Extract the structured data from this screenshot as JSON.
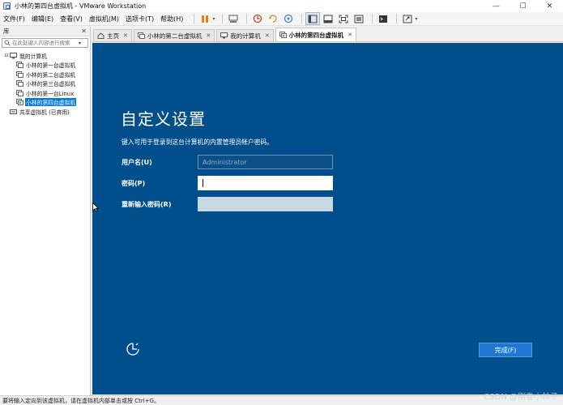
{
  "window": {
    "title": "小林的第四台虚拟机 - VMware Workstation",
    "minimize_glyph": "—",
    "maximize_glyph": "☐",
    "close_glyph": "✕"
  },
  "menu": {
    "items": [
      "文件(F)",
      "编辑(E)",
      "查看(V)",
      "虚拟机(M)",
      "选项卡(T)",
      "帮助(H)"
    ]
  },
  "toolbar": {
    "icons": [
      "pause-icon",
      "send-keys-icon",
      "snapshot-icon",
      "revert-snapshot-icon",
      "snapshot-manager-icon",
      "sidebar-toggle-icon",
      "thumbnail-bar-icon",
      "full-screen-icon",
      "unity-icon",
      "console-icon",
      "stretch-icon"
    ]
  },
  "library": {
    "title": "库",
    "close_glyph": "✕",
    "search_placeholder": "在此处键入内容进行搜索",
    "tree": {
      "root": "我的计算机",
      "children": [
        "小林的第一台虚拟机",
        "小林的第二台虚拟机",
        "小林的第三台虚拟机",
        "小林的第一台Linux",
        "小林的第四台虚拟机"
      ],
      "selected_index": 4,
      "shared": "共享虚拟机 (已弃用)"
    }
  },
  "tabs": [
    {
      "label": "主页",
      "icon": "home-icon"
    },
    {
      "label": "小林的第二台虚拟机",
      "icon": "vm-icon"
    },
    {
      "label": "我的计算机",
      "icon": "computer-icon"
    },
    {
      "label": "小林的第四台虚拟机",
      "icon": "vm-icon"
    }
  ],
  "tab_close_glyph": "✕",
  "active_tab_index": 3,
  "oobe": {
    "title": "自定义设置",
    "instruction": "键入可用于登录到这台计算机的内置管理员帐户密码。",
    "username_label": "用户名(U)",
    "username_value": "Administrator",
    "password_label": "密码(P)",
    "password_value": "",
    "confirm_label": "重新输入密码(R)",
    "confirm_value": "",
    "finish_button": "完成(F)"
  },
  "status": {
    "text": "要将输入定向到该虚拟机，请在虚拟机内部单击或按 Ctrl+G。"
  },
  "watermark": "CSDN @刚卷小林子",
  "colors": {
    "vm_background": "#004e8c",
    "finish_button": "#1f77d1",
    "selection": "#0078d7",
    "pause_icon": "#e8820c"
  }
}
